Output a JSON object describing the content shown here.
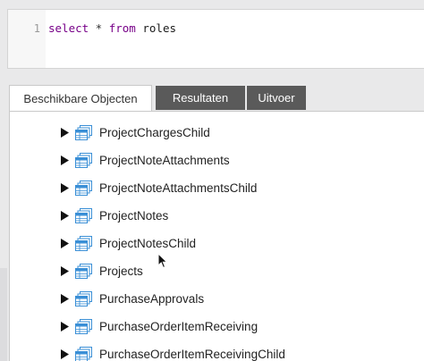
{
  "editor": {
    "line_number": "1",
    "query": {
      "kw_select": "select",
      "star": " * ",
      "kw_from": "from",
      "table": " roles"
    }
  },
  "tabs": [
    {
      "label": "Beschikbare Objecten",
      "active": true
    },
    {
      "label": "Resultaten",
      "active": false
    },
    {
      "label": "Uitvoer",
      "active": false
    }
  ],
  "objects": [
    {
      "name": "ProjectChargesChild"
    },
    {
      "name": "ProjectNoteAttachments"
    },
    {
      "name": "ProjectNoteAttachmentsChild"
    },
    {
      "name": "ProjectNotes"
    },
    {
      "name": "ProjectNotesChild"
    },
    {
      "name": "Projects"
    },
    {
      "name": "PurchaseApprovals"
    },
    {
      "name": "PurchaseOrderItemReceiving"
    },
    {
      "name": "PurchaseOrderItemReceivingChild"
    }
  ],
  "colors": {
    "keyword": "#770088",
    "tab_inactive_bg": "#5a5a5a",
    "icon_blue": "#3a8fd6"
  },
  "icons": {
    "expand": "triangle-right-icon",
    "object": "table-icon"
  }
}
